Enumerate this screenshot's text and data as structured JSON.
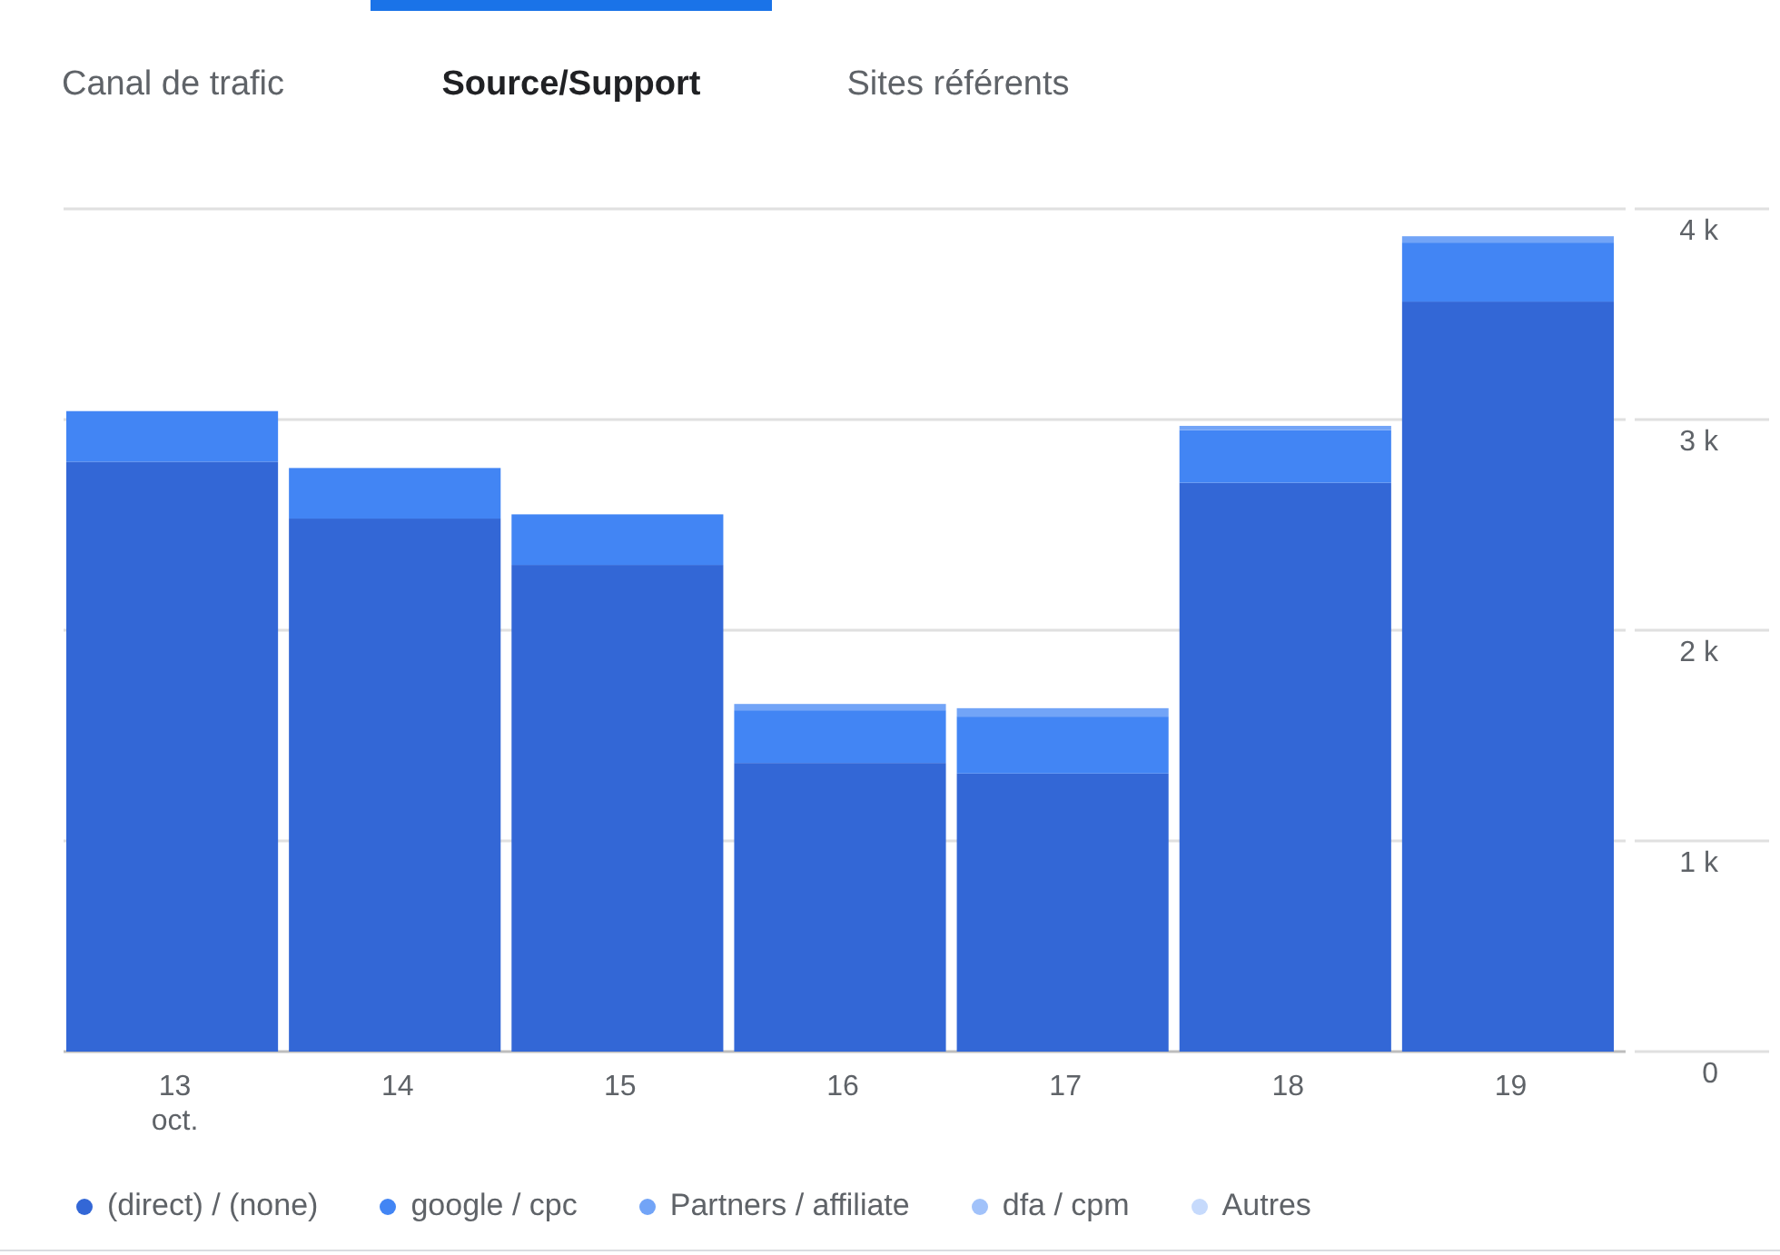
{
  "tabs": [
    {
      "label": "Canal de trafic",
      "selected": false
    },
    {
      "label": "Source/Support",
      "selected": true
    },
    {
      "label": "Sites référents",
      "selected": false
    }
  ],
  "chart": {
    "chart_data": {
      "type": "bar",
      "stacked": true,
      "grid": true,
      "categories": [
        "13 oct.",
        "14",
        "15",
        "16",
        "17",
        "18",
        "19"
      ],
      "ylim": [
        0,
        4000
      ],
      "yticks": [
        {
          "value": 0,
          "label": "0"
        },
        {
          "value": 1000,
          "label": "1 k"
        },
        {
          "value": 2000,
          "label": "2 k"
        },
        {
          "value": 3000,
          "label": "3 k"
        },
        {
          "value": 4000,
          "label": "4 k"
        }
      ],
      "series": [
        {
          "name": "(direct) / (none)",
          "color": "#3367d6",
          "values": [
            2800,
            2530,
            2310,
            1370,
            1320,
            2700,
            3560
          ]
        },
        {
          "name": "google / cpc",
          "color": "#4285f4",
          "values": [
            240,
            240,
            240,
            250,
            270,
            250,
            280
          ]
        },
        {
          "name": "Partners / affiliate",
          "color": "#72a4f7",
          "values": [
            0,
            0,
            0,
            30,
            40,
            20,
            30
          ]
        },
        {
          "name": "dfa / cpm",
          "color": "#a1c2fa",
          "values": [
            0,
            0,
            0,
            0,
            0,
            0,
            0
          ]
        },
        {
          "name": "Autres",
          "color": "#c6dafc",
          "values": [
            0,
            0,
            0,
            0,
            0,
            0,
            0
          ]
        }
      ]
    }
  }
}
